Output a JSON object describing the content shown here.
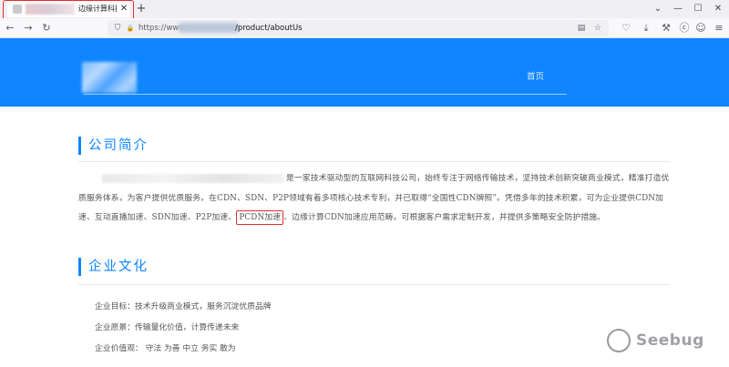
{
  "browser": {
    "tab": {
      "title": "边缘计算科技有",
      "close_glyph": "✕"
    },
    "new_tab_glyph": "+",
    "tabbar_right": {
      "dropdown_glyph": "⌄",
      "minimize_glyph": "—",
      "maximize_glyph": "☐",
      "close_glyph": "✕"
    },
    "nav": {
      "back_glyph": "←",
      "forward_glyph": "→",
      "reload_glyph": "↻"
    },
    "url": {
      "prefix": "https://www.",
      "path": "/product/aboutUs"
    },
    "url_icons": {
      "shield_glyph": "⛉",
      "lock_glyph": "🔒",
      "reader_glyph": "▤",
      "star_glyph": "☆"
    },
    "toolbar": {
      "pocket_glyph": "♡",
      "download_glyph": "⤓",
      "tools_glyph": "⚒",
      "extension_glyph": "ⓒ",
      "profile_glyph": "☺",
      "menu_glyph": "≡"
    },
    "highlight_color": "#e0302b"
  },
  "site": {
    "brand_color": "#0f85ff",
    "nav": {
      "home": "首页"
    },
    "intro": {
      "title": "公司简介",
      "p_part1": "是一家技术驱动型的互联网科技公司，始终专注于网络传输技术，坚持技术创新突破商业模式，精准打造优质服务体系，为客户提供优质服务。在CDN、SDN、P2P领域有着多项核心技术专利，并已取得“全国性CDN牌照”。凭借多年的技术积累，可为企业提供CDN加速、互动直播加速、SDN加速、P2P加速、",
      "p_highlight": "PCDN加速",
      "p_part2": "、边缘计算CDN加速应用范畴。可根据客户需求定制开发，并提供多策略安全防护措施。"
    },
    "culture": {
      "title": "企业文化",
      "items": [
        "企业目标：技术升级商业模式，服务沉淀优质品牌",
        "企业愿景：传输量化价值，计算传递未来",
        "企业价值观：  守法 为善 中立 务实 敢为"
      ]
    }
  },
  "watermark": {
    "text": "Seebug",
    "icon_glyph": "⬆"
  }
}
